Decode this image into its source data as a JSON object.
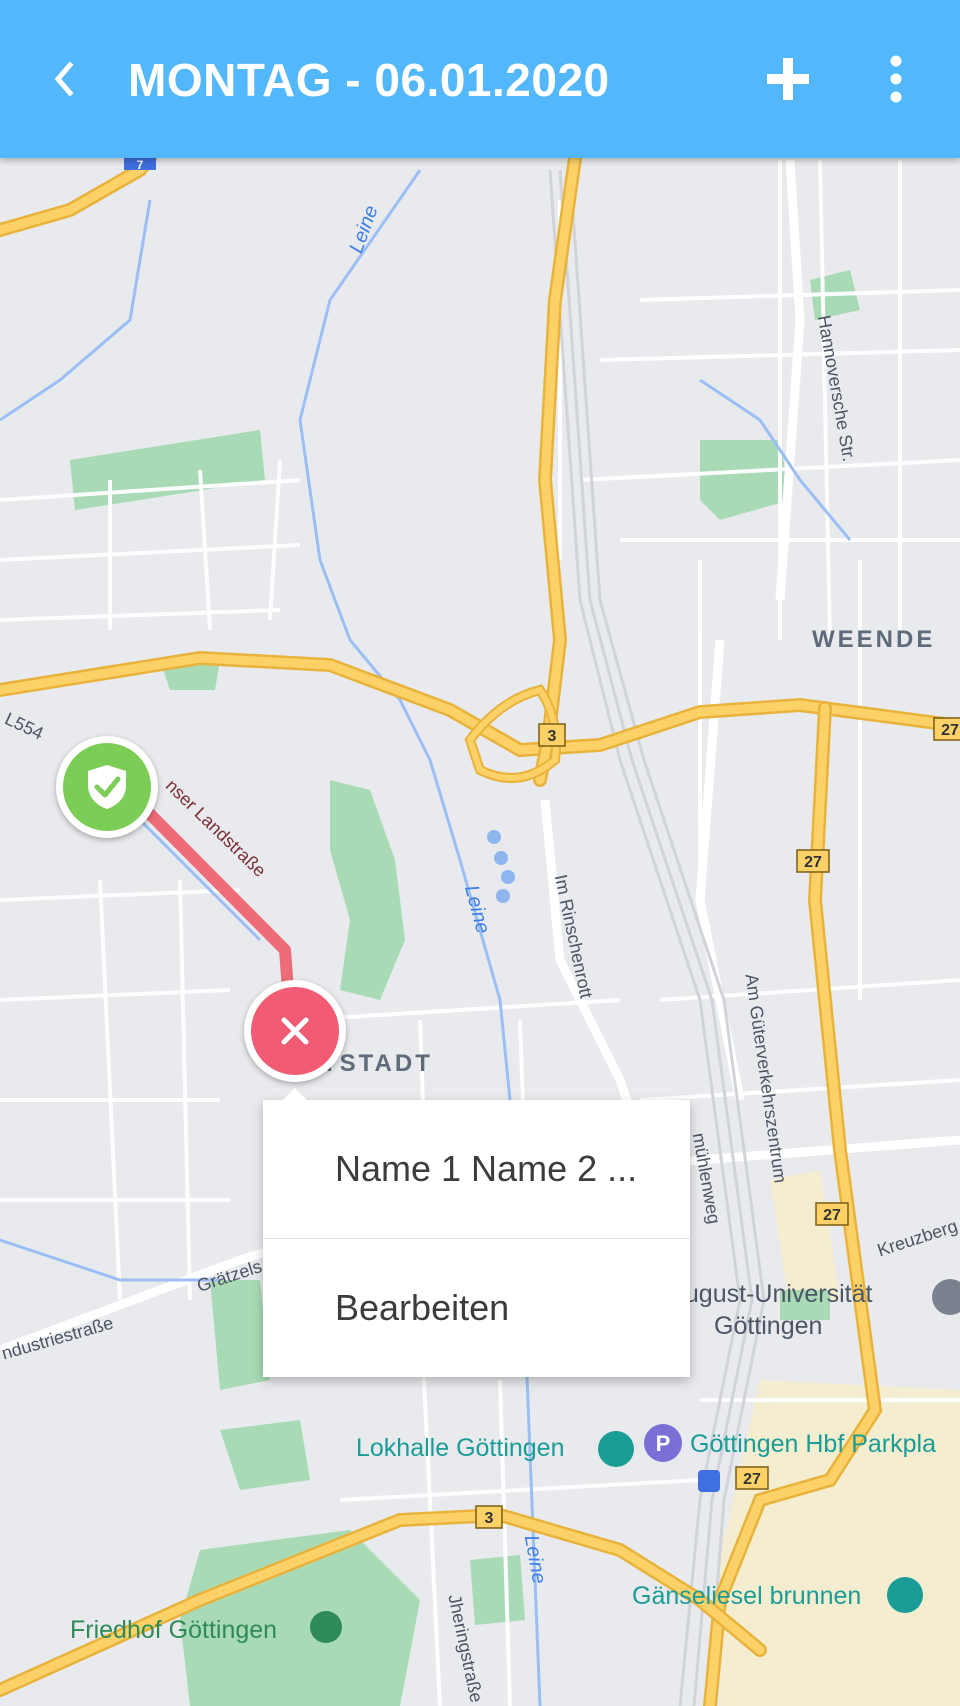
{
  "app_bar": {
    "title": "MONTAG - 06.01.2020",
    "back_icon": "chevron-left-icon",
    "add_icon": "plus-icon",
    "more_icon": "more-vert-icon"
  },
  "map": {
    "labels": {
      "weende": "WEENDE",
      "district_partial": "TSTADT",
      "lokhalle": "Lokhalle Göttingen",
      "parking": "Göttingen Hbf Parkpla",
      "uni_line1": "g-August-Universität",
      "uni_line2": "Göttingen",
      "gaenseliesel": "Gänseliesel brunnen",
      "friedhof": "Friedhof Göttingen",
      "leine_top": "Leine",
      "leine_mid": "Leine",
      "leine_bottom": "Leine",
      "hannoversche": "Hannoversche Str.",
      "im_rinschenrott": "Im Rinschenrott",
      "am_gueter": "Am Güterverkehrszentrum",
      "muehlenweg": "mühlenweg",
      "kreuzberg": "Kreuzberg",
      "graetzel": "Grätzels",
      "industrie": "ndustriestraße",
      "jhering": "Jheringstraße",
      "landstrasse": "nser Landstraße",
      "l554": "L554"
    },
    "road_shields": [
      "3",
      "3",
      "27",
      "27",
      "27",
      "27",
      "7"
    ],
    "marker_start_icon": "shield-check-icon",
    "marker_end_icon": "close-icon"
  },
  "popup": {
    "name_item": "Name 1 Name 2 ...",
    "edit_item": "Bearbeiten"
  },
  "colors": {
    "app_bar": "#53b7fb",
    "start_marker": "#7ccd55",
    "end_marker": "#f15b74",
    "route": "#ee5d6c"
  }
}
